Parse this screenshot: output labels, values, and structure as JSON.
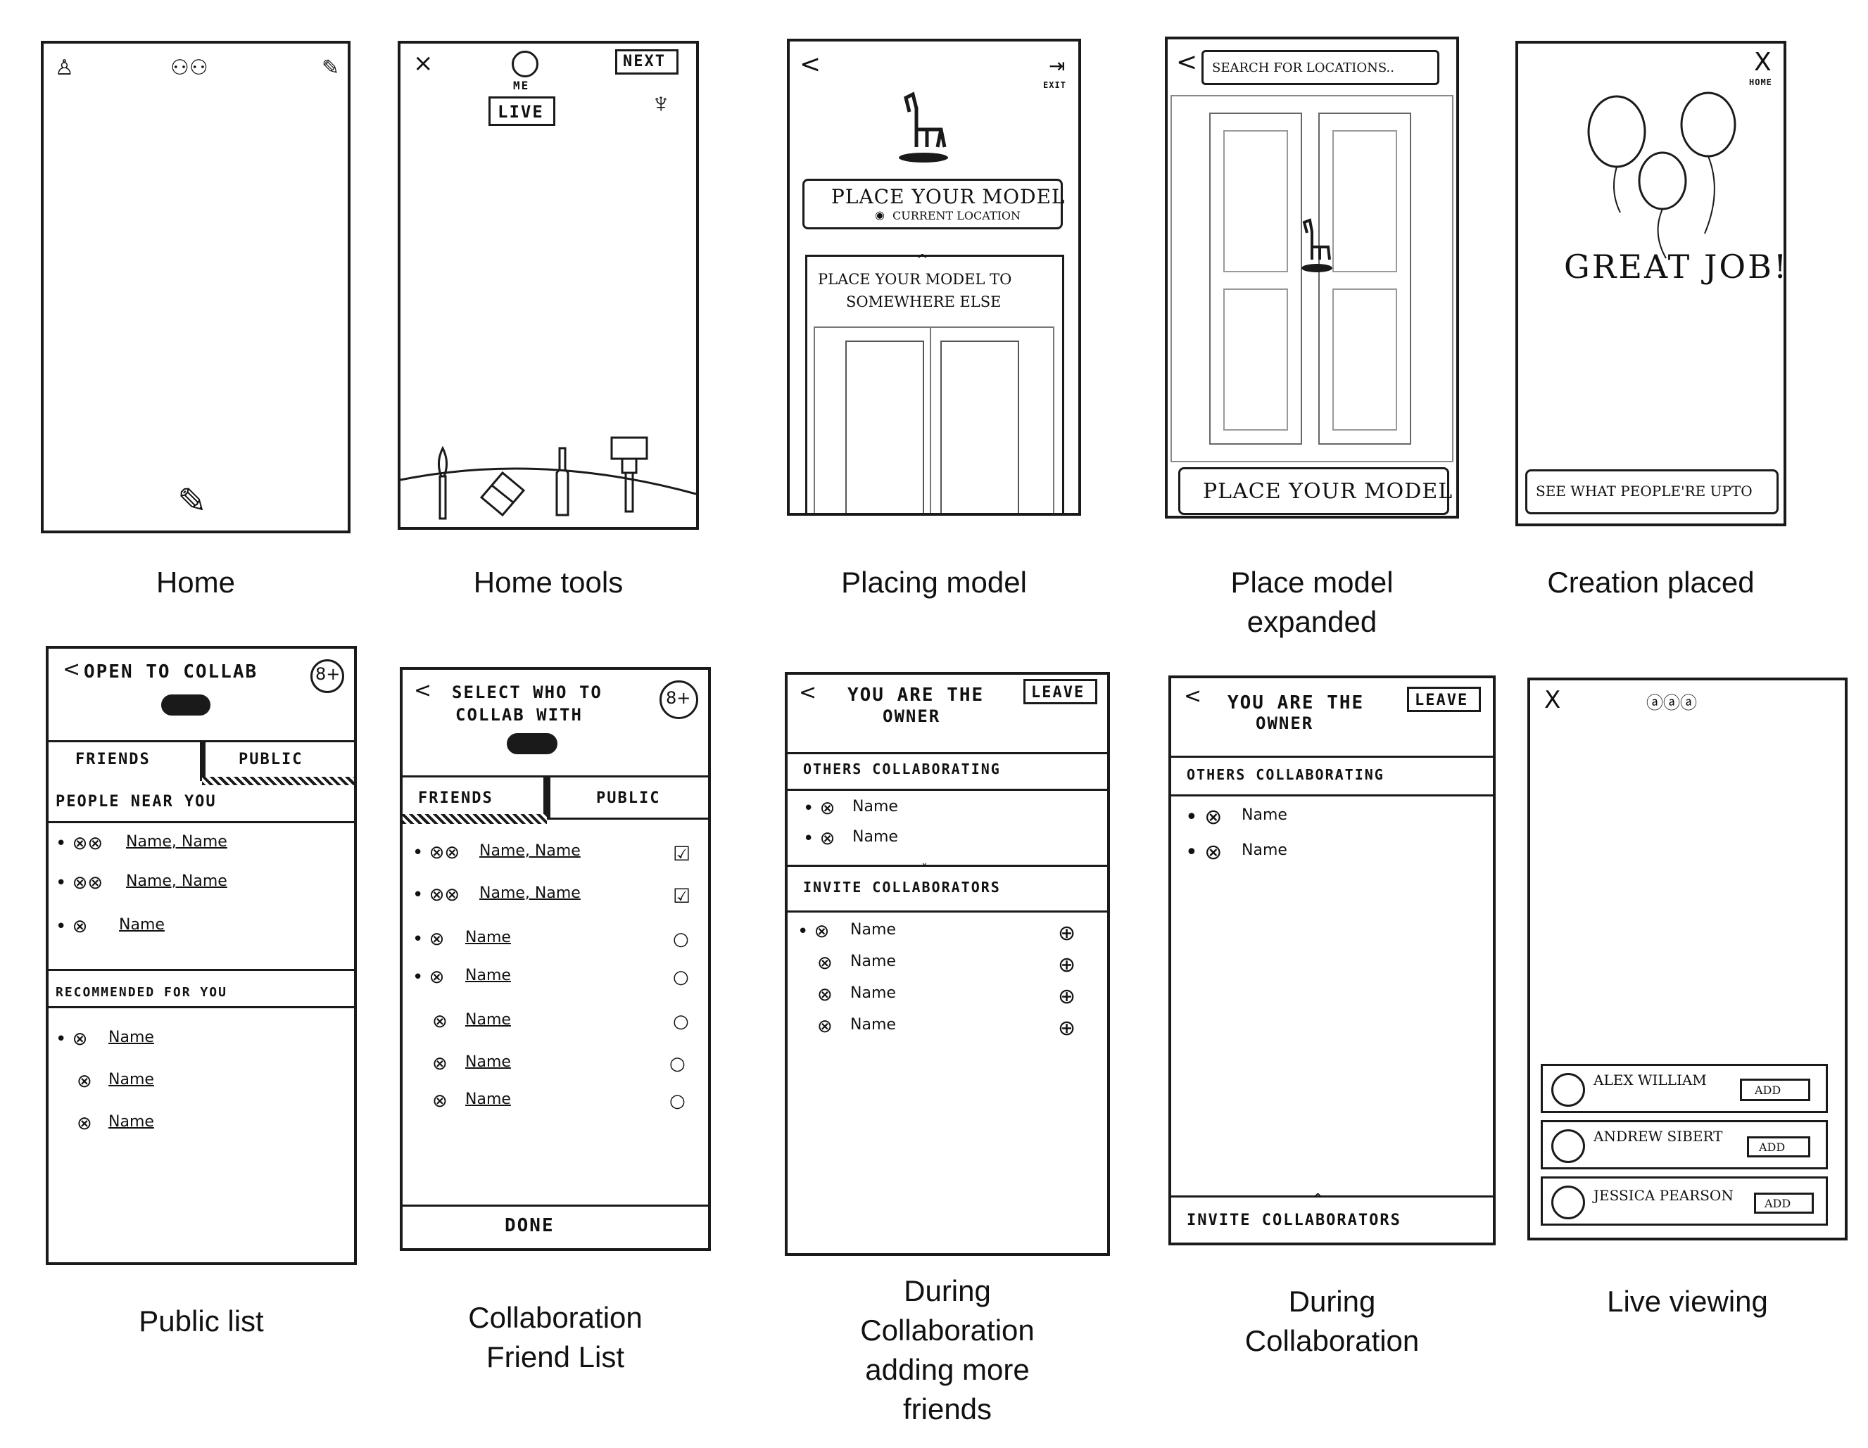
{
  "captions": {
    "home": "Home",
    "home_tools": "Home tools",
    "placing_model": "Placing model",
    "place_model_expanded_1": "Place model",
    "place_model_expanded_2": "expanded",
    "creation_placed": "Creation placed",
    "public_list": "Public list",
    "collab_friend_list_1": "Collaboration",
    "collab_friend_list_2": "Friend List",
    "during_collab_adding_1": "During",
    "during_collab_adding_2": "Collaboration",
    "during_collab_adding_3": "adding more",
    "during_collab_adding_4": "friends",
    "during_collab_1": "During",
    "during_collab_2": "Collaboration",
    "live_viewing": "Live viewing"
  },
  "home_tools": {
    "close": "×",
    "me": "ME",
    "next": "NEXT",
    "live": "LIVE"
  },
  "placing_model": {
    "back": "<",
    "exit": "EXIT",
    "place_button": "PLACE YOUR MODEL",
    "current_location": "CURRENT LOCATION",
    "panel_text_1": "PLACE YOUR MODEL TO",
    "panel_text_2": "SOMEWHERE ELSE"
  },
  "place_model_expanded": {
    "back": "<",
    "search_placeholder": "SEARCH FOR LOCATIONS..",
    "place_button": "PLACE YOUR MODEL"
  },
  "creation_placed": {
    "close": "X",
    "home": "HOME",
    "great_job": "GREAT JOB!",
    "see_button": "SEE WHAT PEOPLE'RE UPTO"
  },
  "public_list": {
    "back": "<",
    "title": "OPEN TO COLLAB",
    "tab_friends": "FRIENDS",
    "tab_public": "PUBLIC",
    "section_near": "PEOPLE NEAR YOU",
    "near_items": [
      "Name, Name",
      "Name, Name",
      "Name"
    ],
    "section_recommended": "RECOMMENDED FOR YOU",
    "recommended_items": [
      "Name",
      "Name",
      "Name"
    ]
  },
  "collab_friend_list": {
    "back": "<",
    "title_1": "SELECT WHO TO",
    "title_2": "COLLAB WITH",
    "tab_friends": "FRIENDS",
    "tab_public": "PUBLIC",
    "items": [
      "Name, Name",
      "Name, Name",
      "Name",
      "Name",
      "Name",
      "Name",
      "Name"
    ],
    "done": "DONE"
  },
  "during_collab_adding": {
    "back": "<",
    "title_1": "YOU ARE THE",
    "title_2": "OWNER",
    "leave": "LEAVE",
    "others_header": "OTHERS COLLABORATING",
    "others": [
      "Name",
      "Name"
    ],
    "invite_header": "INVITE COLLABORATORS",
    "invite_items": [
      "Name",
      "Name",
      "Name",
      "Name"
    ]
  },
  "during_collab": {
    "back": "<",
    "title_1": "YOU ARE THE",
    "title_2": "OWNER",
    "leave": "LEAVE",
    "others_header": "OTHERS COLLABORATING",
    "others": [
      "Name",
      "Name"
    ],
    "invite_footer": "INVITE COLLABORATORS"
  },
  "live_viewing": {
    "close": "X",
    "viewers": [
      {
        "name": "ALEX WILLIAM",
        "add": "ADD"
      },
      {
        "name": "ANDREW SIBERT",
        "add": "ADD"
      },
      {
        "name": "JESSICA PEARSON",
        "add": "ADD"
      }
    ]
  }
}
